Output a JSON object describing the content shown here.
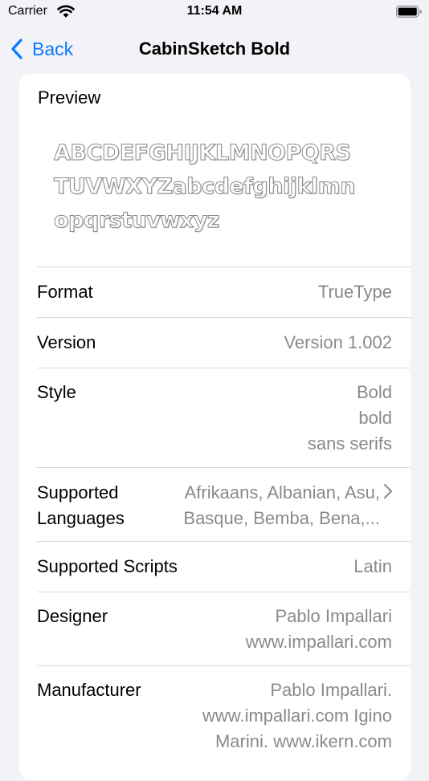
{
  "status": {
    "carrier": "Carrier",
    "time": "11:54 AM"
  },
  "nav": {
    "back_label": "Back",
    "title": "CabinSketch Bold"
  },
  "preview": {
    "label": "Preview",
    "lines": [
      "ABCDEFGHIJKLMNOPQRS",
      "TUVWXYZabcdefghijklmn",
      "opqrstuvwxyz"
    ]
  },
  "rows": {
    "format": {
      "key": "Format",
      "value": "TrueType"
    },
    "version": {
      "key": "Version",
      "value": "Version 1.002"
    },
    "style": {
      "key": "Style",
      "value": "Bold\nbold\nsans serifs"
    },
    "languages": {
      "key": "Supported\nLanguages",
      "value": "Afrikaans, Albanian, Asu,\nBasque, Bemba, Bena,..."
    },
    "scripts": {
      "key": "Supported Scripts",
      "value": "Latin"
    },
    "designer": {
      "key": "Designer",
      "value": "Pablo Impallari\nwww.impallari.com"
    },
    "manufacturer": {
      "key": "Manufacturer",
      "value": "Pablo Impallari.\nwww.impallari.com Igino\nMarini. www.ikern.com"
    }
  },
  "icons": {
    "back": "chevron-left-icon",
    "disclosure": "chevron-right-icon",
    "wifi": "wifi-icon",
    "battery": "battery-icon"
  },
  "colors": {
    "accent": "#0a7aff",
    "secondary_text": "#8a8a8e",
    "background": "#f2f2f7"
  }
}
